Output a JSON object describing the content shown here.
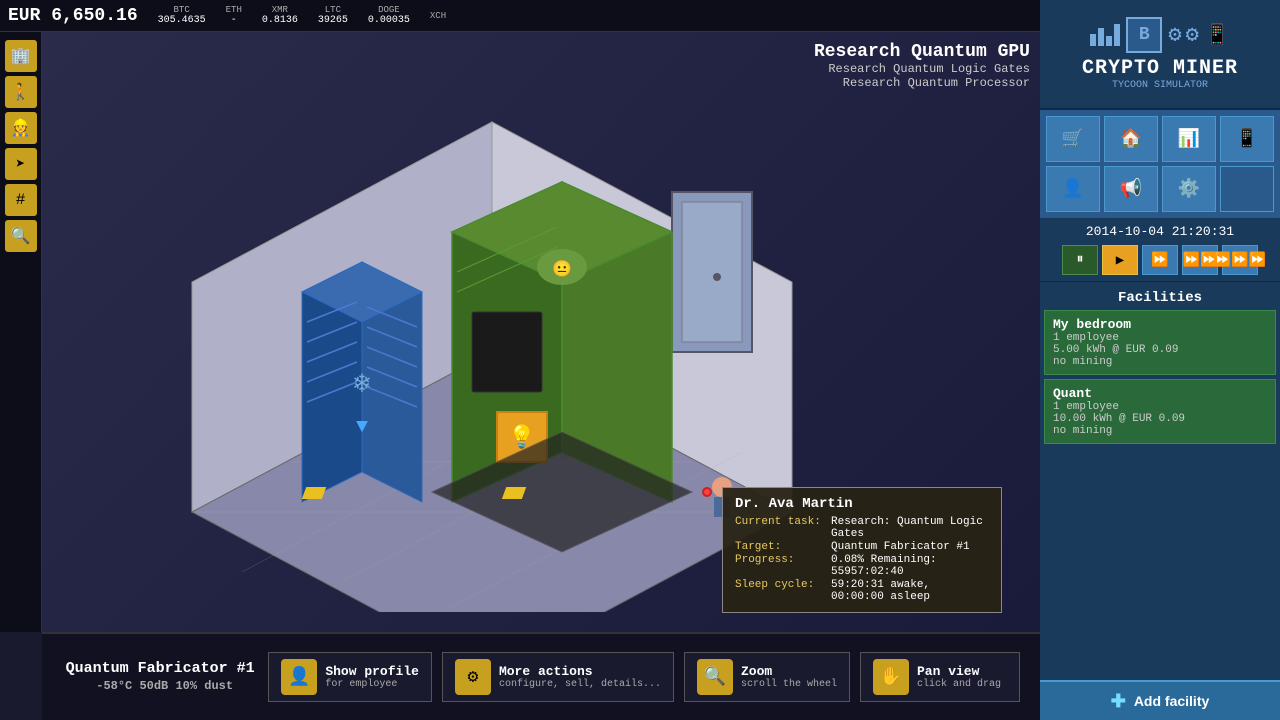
{
  "topbar": {
    "currency": "EUR 6,650.16",
    "cryptos": [
      {
        "name": "BTC",
        "value": "305.4635"
      },
      {
        "name": "ETH",
        "value": "-"
      },
      {
        "name": "XMR",
        "value": "0.8136"
      },
      {
        "name": "LTC",
        "value": "39265"
      },
      {
        "name": "DOGE",
        "value": "0.00035"
      },
      {
        "name": "XCH",
        "value": ""
      }
    ]
  },
  "research": {
    "title": "Research Quantum GPU",
    "sub1": "Research Quantum Logic Gates",
    "sub2": "Research Quantum Processor"
  },
  "facility_info": {
    "name": "Quantum Fabricator #1",
    "stats": "-58°C  50dB  10% dust"
  },
  "employee_tooltip": {
    "name": "Dr. Ava Martin",
    "current_task_label": "Current task:",
    "current_task_value": "Research: Quantum Logic Gates",
    "target_label": "Target:",
    "target_value": "Quantum Fabricator #1",
    "progress_label": "Progress:",
    "progress_value": "0.08%  Remaining: 55957:02:40",
    "sleep_label": "Sleep cycle:",
    "sleep_value": "59:20:31 awake, 00:00:00 asleep"
  },
  "action_buttons": [
    {
      "title": "Show profile",
      "sub": "for employee"
    },
    {
      "title": "More actions",
      "sub": "configure, sell, details..."
    },
    {
      "title": "Zoom",
      "sub": "scroll the wheel"
    },
    {
      "title": "Pan view",
      "sub": "click and drag"
    }
  ],
  "logo": {
    "title": "CRYPTO MINER",
    "sub": "TYCOON SIMULATOR"
  },
  "datetime": "2014-10-04 21:20:31",
  "facilities_title": "Facilities",
  "facilities": [
    {
      "name": "My bedroom",
      "employees": "1 employee",
      "power": "5.00 kWh @ EUR 0.09",
      "mining": "no mining"
    },
    {
      "name": "Quant",
      "employees": "1 employee",
      "power": "10.00 kWh @ EUR 0.09",
      "mining": "no mining"
    }
  ],
  "add_facility_label": "Add facility",
  "speed_buttons": [
    "⏸",
    "▶",
    "⏩",
    "⏩⏩",
    "⏩⏩⏩"
  ],
  "nav_icons": [
    {
      "name": "shop",
      "icon": "🛒"
    },
    {
      "name": "facility",
      "icon": "🏠"
    },
    {
      "name": "stats",
      "icon": "📊"
    },
    {
      "name": "phone",
      "icon": "📱"
    },
    {
      "name": "person",
      "icon": "👤"
    },
    {
      "name": "megaphone",
      "icon": "📢"
    },
    {
      "name": "settings",
      "icon": "⚙️"
    },
    {
      "name": "empty",
      "icon": ""
    }
  ],
  "left_icons": [
    "🏢",
    "🚶",
    "👷",
    "➤",
    "#",
    "🔍"
  ]
}
